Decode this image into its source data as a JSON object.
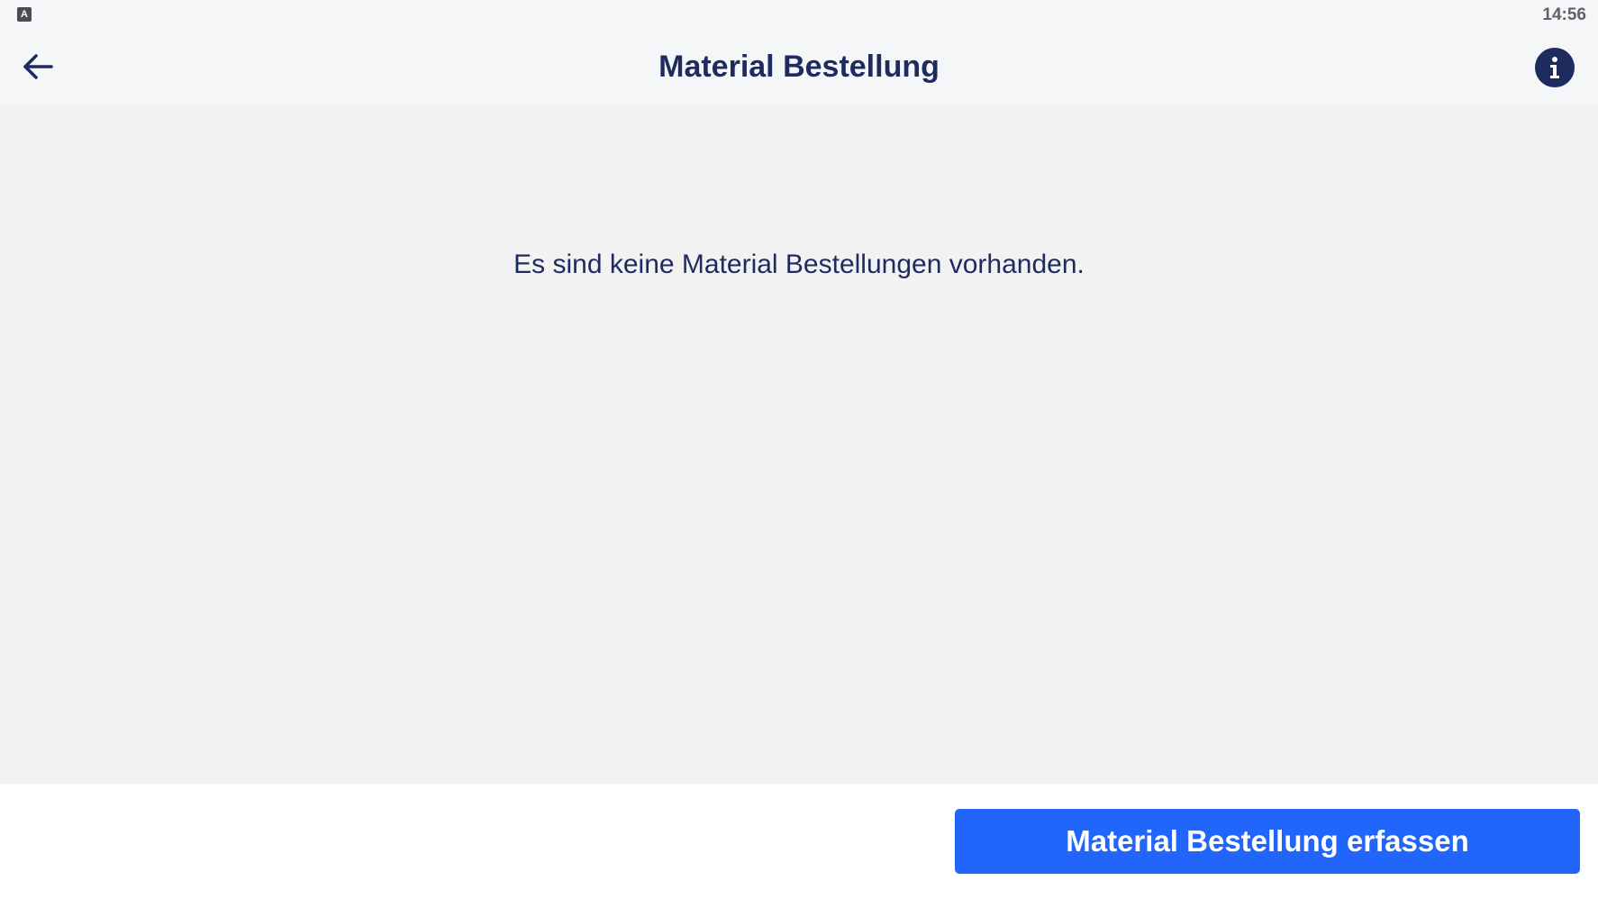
{
  "status_bar": {
    "app_icon_letter": "A",
    "time": "14:56"
  },
  "app_bar": {
    "title": "Material Bestellung",
    "back_icon": "arrow-left-icon",
    "info_icon": "info-icon"
  },
  "main": {
    "empty_message": "Es sind keine Material Bestellungen vorhanden."
  },
  "footer": {
    "primary_button_label": "Material Bestellung erfassen"
  },
  "colors": {
    "primary": "#2165fb",
    "navy": "#1e2b5f",
    "appbar_bg": "#f5f6f8",
    "content_bg": "#f2f2f2"
  }
}
